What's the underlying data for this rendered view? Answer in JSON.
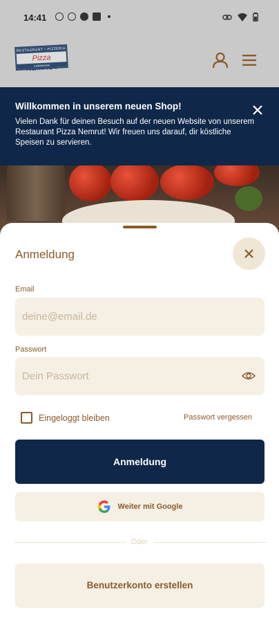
{
  "status_bar": {
    "time": "14:41"
  },
  "header": {
    "logo": {
      "top": "RESTAURANT • PIZZERIA",
      "brand_prefix": "Pizza",
      "brand_name": "NEMRUT",
      "bottom": "Lieferservice"
    },
    "icons": [
      "user-icon",
      "menu-icon"
    ]
  },
  "banner": {
    "title": "Willkommen in unserem neuen Shop!",
    "text": "Vielen Dank für deinen Besuch auf der neuen Website von unserem Restaurant Pizza Nemrut! Wir freuen uns darauf, dir köstliche Speisen zu servieren."
  },
  "login": {
    "title": "Anmeldung",
    "email_label": "Email",
    "email_placeholder": "deine@email.de",
    "email_value": "",
    "password_label": "Passwort",
    "password_placeholder": "Dein Passwort",
    "password_value": "",
    "remember_label": "Eingeloggt bleiben",
    "remember_checked": false,
    "forgot_label": "Passwort vergessen",
    "submit_label": "Anmeldung",
    "google_label": "Weiter mit Google",
    "divider_label": "Oder",
    "register_label": "Benutzerkonto erstellen"
  },
  "colors": {
    "navy": "#0f2748",
    "brown": "#8a5a2a",
    "cream": "#f5efe4"
  }
}
